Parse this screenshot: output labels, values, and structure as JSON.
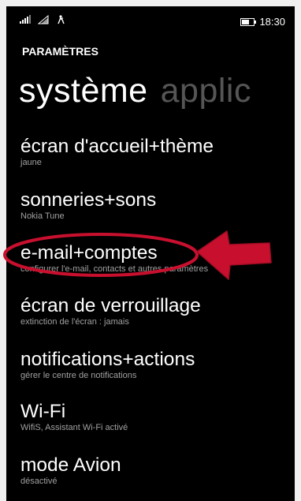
{
  "status_bar": {
    "time": "18:30",
    "icons": [
      "signal-icon",
      "wifi-icon",
      "quiet-hours-icon",
      "battery-icon"
    ]
  },
  "header": {
    "label": "PARAMÈTRES"
  },
  "pivot": {
    "active": "système",
    "next": "applic"
  },
  "settings": [
    {
      "title": "écran d'accueil+thème",
      "subtitle": "jaune"
    },
    {
      "title": "sonneries+sons",
      "subtitle": "Nokia Tune"
    },
    {
      "title": "e-mail+comptes",
      "subtitle": "configurer l'e-mail, contacts et autres paramètres"
    },
    {
      "title": "écran de verrouillage",
      "subtitle": "extinction de l'écran : jamais"
    },
    {
      "title": "notifications+actions",
      "subtitle": "gérer le centre de notifications"
    },
    {
      "title": "Wi-Fi",
      "subtitle": "WifiS, Assistant Wi-Fi activé"
    },
    {
      "title": "mode Avion",
      "subtitle": "désactivé"
    }
  ],
  "colors": {
    "background": "#000000",
    "text": "#ffffff",
    "subtext": "#a0a0a0",
    "annotation": "#c8102e",
    "inactive_pivot": "#555555"
  }
}
